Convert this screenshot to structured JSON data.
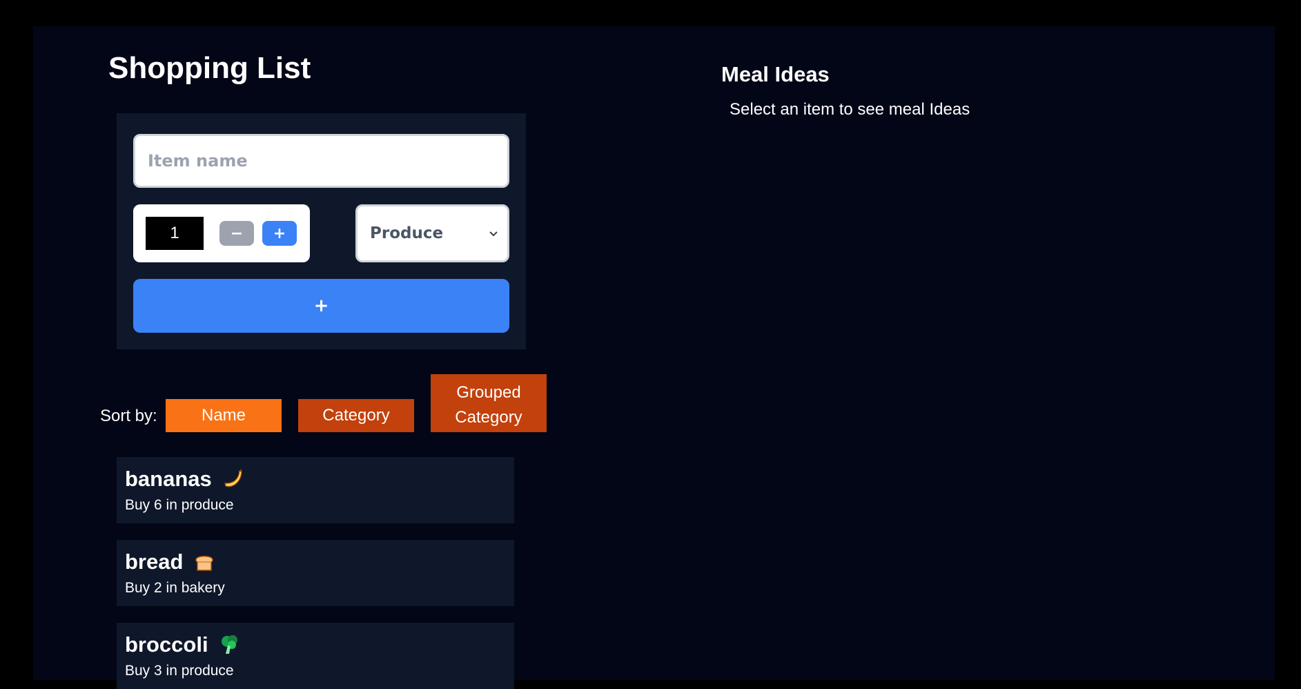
{
  "shopping": {
    "title": "Shopping List",
    "form": {
      "item_placeholder": "Item name",
      "quantity": "1",
      "minus_label": "−",
      "plus_label": "+",
      "category_selected": "Produce",
      "add_label": "+"
    },
    "sort": {
      "label": "Sort by:",
      "name_label": "Name",
      "category_label": "Category",
      "grouped_label_line1": "Grouped",
      "grouped_label_line2": "Category",
      "active": "name"
    },
    "items": [
      {
        "name": "bananas",
        "description": "Buy 6 in produce",
        "icon": "banana-icon"
      },
      {
        "name": "bread",
        "description": "Buy 2 in bakery",
        "icon": "bread-icon"
      },
      {
        "name": "broccoli",
        "description": "Buy 3 in produce",
        "icon": "broccoli-icon"
      }
    ]
  },
  "meal_ideas": {
    "title": "Meal Ideas",
    "hint": "Select an item to see meal Ideas"
  },
  "colors": {
    "background": "#020617",
    "card": "#0f172a",
    "primary_blue": "#3b82f6",
    "sort_active": "#f97316",
    "sort_inactive": "#c2410c"
  }
}
